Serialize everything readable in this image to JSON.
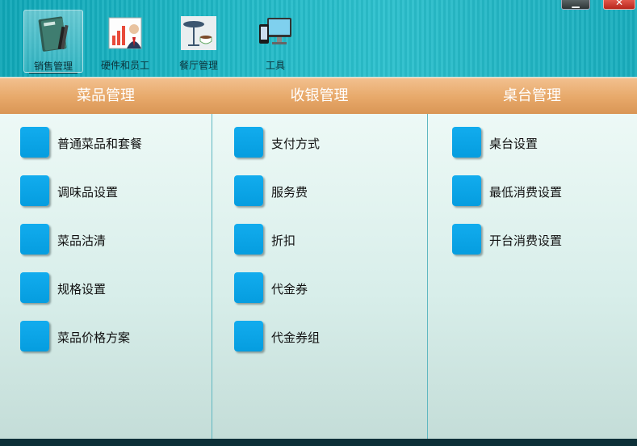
{
  "toolbar": {
    "tools": [
      {
        "label": "销售管理",
        "icon": "book-icon"
      },
      {
        "label": "硬件和员工",
        "icon": "presentation-icon"
      },
      {
        "label": "餐厅管理",
        "icon": "cafe-table-icon"
      },
      {
        "label": "工具",
        "icon": "devices-icon"
      }
    ],
    "window": {
      "minimize_glyph": "▁",
      "close_glyph": "✕"
    }
  },
  "columns": [
    {
      "title": "菜品管理",
      "items": [
        "普通菜品和套餐",
        "调味品设置",
        "菜品沽清",
        "规格设置",
        "菜品价格方案"
      ]
    },
    {
      "title": "收银管理",
      "items": [
        "支付方式",
        "服务费",
        "折扣",
        "代金券",
        "代金券组"
      ]
    },
    {
      "title": "桌台管理",
      "items": [
        "桌台设置",
        "最低消费设置",
        "开台消费设置"
      ]
    }
  ],
  "colors": {
    "accent_square": "#07a2e6",
    "header": "#e7a869",
    "toolbar": "#1fb8c6"
  }
}
